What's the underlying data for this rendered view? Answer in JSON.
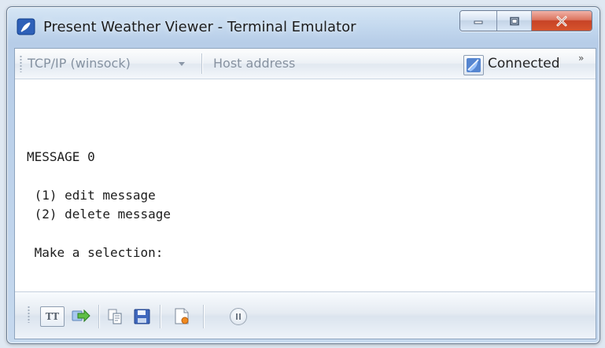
{
  "window": {
    "title": "Present Weather Viewer - Terminal Emulator"
  },
  "toolbar": {
    "connection_type": "TCP/IP (winsock)",
    "host_address_placeholder": "Host address",
    "status": "Connected",
    "overflow_glyph": "»"
  },
  "terminal": {
    "lines": [
      "MESSAGE 0",
      " (1) edit message",
      " (2) delete message",
      " Make a selection:"
    ]
  },
  "bottom_toolbar": {
    "tt_label": "TT"
  },
  "colors": {
    "title_bar_light": "#d6e6f5",
    "title_bar_dark": "#b7cde8",
    "close_button": "#c74326",
    "terminal_background": "#ffffff",
    "terminal_text": "#1c1c1c"
  },
  "icons": {
    "app": "terminal-icon",
    "minimize": "minimize-icon",
    "maximize": "maximize-icon",
    "close": "close-icon",
    "dropdown": "chevron-down-icon",
    "connection_status": "connection-status-icon",
    "overflow": "chevron-right-double-icon",
    "terminal_type": "terminal-type-icon",
    "send": "send-icon",
    "copy": "copy-icon",
    "save": "save-icon",
    "log": "log-file-icon",
    "pause": "pause-icon"
  }
}
